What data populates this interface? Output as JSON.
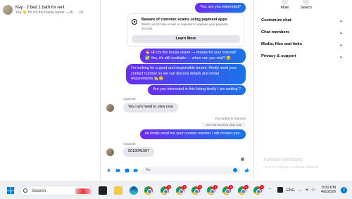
{
  "conversation_list": [
    {
      "name": "Kay · 2 bed 1 bath for rent",
      "snippet": "You 👋 Hi! I'm the house owner — th...",
      "time": "1h"
    }
  ],
  "chat": {
    "scam_card": {
      "title": "Beware of common scams using payment apps",
      "description": "Watch out for fake emails or requests to upgrade your payment account.",
      "button": "Learn More"
    },
    "messages": {
      "m0": "Yes, are you interested?",
      "m1": "👋 Hi! I'm the house owner — thanks for your interest! ✅ Yes, it's still available — when can you visit? 😊",
      "m2": "I'm looking for a good and responsible tenant. Kindly send your contact number so we can discuss details and rental requirements 🏡😊",
      "m3": "Are you interested in this listing kindly I am waiting ?",
      "sender1": "Ayannah",
      "m4": "Yes I am need to view now",
      "reply_note": "You replied to Ayannah",
      "reply_quote": "Yes I am need to view now",
      "m5": "ok kindly send me your contact number I will contact you.",
      "sender2": "Ayannah",
      "m6": "5013041997"
    },
    "composer_placeholder": "Aa"
  },
  "right_panel": {
    "top": {
      "mute": "Mute",
      "search": "Search"
    },
    "items": [
      "Customize chat",
      "Chat members",
      "Media, files and links",
      "Privacy & support"
    ],
    "watermark": {
      "title": "Activate Windows",
      "subtitle": "Go to PC settings to activate Windows."
    }
  },
  "taskbar": {
    "search": "Search",
    "lang": "ENG",
    "time": "9:00 PM",
    "date": "4/6/2026",
    "notifications": "2",
    "badges": [
      "1",
      "2",
      "1",
      "1",
      "1",
      "1",
      "1"
    ]
  },
  "colors": {
    "messenger_gradient_start": "#6b2cf5",
    "messenger_gradient_end": "#1a73e8",
    "incoming_bubble": "#e4e6eb"
  }
}
